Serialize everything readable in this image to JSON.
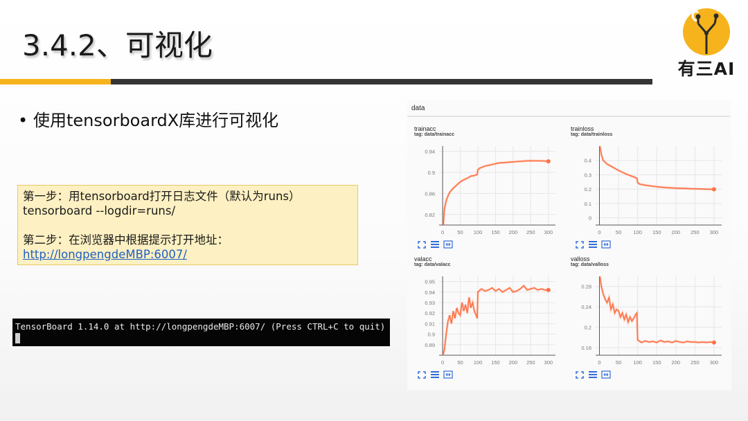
{
  "slide": {
    "title": "3.4.2、可视化",
    "logo_text": "有三AI",
    "bullet": "使用tensorboardX库进行可视化",
    "steps": {
      "line1": "第一步：用tensorboard打开日志文件（默认为runs）",
      "line2": "tensorboard --logdir=runs/",
      "line3": "第二步：在浏览器中根据提示打开地址：",
      "link": "http://longpengdeMBP:6007/"
    },
    "terminal": {
      "line1": "TensorBoard 1.14.0 at http://longpengdeMBP:6007/ (Press CTRL+C to quit)"
    },
    "colors": {
      "accent_yellow": "#f6b31c",
      "bar_dark": "#353535",
      "series": "#ff7043"
    }
  },
  "tensorboard": {
    "header": "data",
    "icons": [
      "expand-icon",
      "list-icon",
      "fit-domain-icon"
    ]
  },
  "chart_data": [
    {
      "type": "line",
      "title": "trainacc",
      "tag": "tag: data/trainacc",
      "xticks": [
        0,
        50,
        100,
        150,
        200,
        250,
        300
      ],
      "yticks": [
        0.82,
        0.86,
        0.9,
        0.94
      ],
      "xlim": [
        -10,
        320
      ],
      "ylim": [
        0.8,
        0.95
      ],
      "x": [
        2,
        5,
        10,
        15,
        20,
        30,
        40,
        50,
        60,
        70,
        80,
        90,
        98,
        100,
        105,
        120,
        140,
        160,
        180,
        200,
        220,
        240,
        260,
        280,
        300
      ],
      "y": [
        0.8,
        0.83,
        0.846,
        0.855,
        0.862,
        0.87,
        0.876,
        0.882,
        0.886,
        0.889,
        0.893,
        0.894,
        0.896,
        0.905,
        0.908,
        0.912,
        0.915,
        0.918,
        0.919,
        0.92,
        0.921,
        0.922,
        0.922,
        0.922,
        0.921
      ]
    },
    {
      "type": "line",
      "title": "trainloss",
      "tag": "tag: data/trainloss",
      "xticks": [
        0,
        50,
        100,
        150,
        200,
        250,
        300
      ],
      "yticks": [
        0,
        0.1,
        0.2,
        0.3,
        0.4
      ],
      "xlim": [
        -10,
        320
      ],
      "ylim": [
        -0.05,
        0.5
      ],
      "x": [
        1,
        5,
        10,
        20,
        30,
        40,
        50,
        60,
        70,
        80,
        90,
        98,
        100,
        105,
        120,
        140,
        160,
        180,
        200,
        220,
        240,
        260,
        280,
        300
      ],
      "y": [
        0.5,
        0.44,
        0.4,
        0.375,
        0.36,
        0.345,
        0.33,
        0.318,
        0.305,
        0.295,
        0.285,
        0.275,
        0.245,
        0.235,
        0.228,
        0.22,
        0.214,
        0.21,
        0.207,
        0.205,
        0.203,
        0.202,
        0.2,
        0.199
      ]
    },
    {
      "type": "line",
      "title": "valacc",
      "tag": "tag: data/valacc",
      "xticks": [
        0,
        50,
        100,
        150,
        200,
        250,
        300
      ],
      "yticks": [
        0.89,
        0.9,
        0.91,
        0.92,
        0.93,
        0.94,
        0.95
      ],
      "xlim": [
        -10,
        320
      ],
      "ylim": [
        0.88,
        0.955
      ],
      "x": [
        1,
        5,
        10,
        15,
        20,
        25,
        30,
        35,
        40,
        45,
        50,
        55,
        60,
        65,
        70,
        75,
        80,
        85,
        90,
        95,
        98,
        100,
        110,
        120,
        130,
        140,
        150,
        160,
        170,
        180,
        190,
        200,
        210,
        220,
        230,
        240,
        250,
        260,
        270,
        280,
        290,
        300
      ],
      "y": [
        0.88,
        0.885,
        0.9,
        0.912,
        0.918,
        0.91,
        0.922,
        0.915,
        0.925,
        0.92,
        0.918,
        0.93,
        0.922,
        0.928,
        0.92,
        0.935,
        0.925,
        0.93,
        0.922,
        0.918,
        0.915,
        0.94,
        0.943,
        0.941,
        0.942,
        0.944,
        0.941,
        0.943,
        0.94,
        0.942,
        0.944,
        0.94,
        0.941,
        0.943,
        0.946,
        0.942,
        0.943,
        0.944,
        0.942,
        0.943,
        0.942,
        0.942
      ]
    },
    {
      "type": "line",
      "title": "valloss",
      "tag": "tag: data/valloss",
      "xticks": [
        0,
        50,
        100,
        150,
        200,
        250,
        300
      ],
      "yticks": [
        0.16,
        0.2,
        0.24,
        0.28
      ],
      "xlim": [
        -10,
        320
      ],
      "ylim": [
        0.145,
        0.3
      ],
      "x": [
        1,
        5,
        10,
        15,
        20,
        25,
        30,
        35,
        40,
        45,
        50,
        55,
        60,
        65,
        70,
        75,
        80,
        85,
        90,
        95,
        98,
        100,
        110,
        120,
        130,
        140,
        150,
        160,
        170,
        180,
        190,
        200,
        210,
        220,
        230,
        240,
        250,
        260,
        270,
        280,
        290,
        300
      ],
      "y": [
        0.3,
        0.28,
        0.265,
        0.255,
        0.248,
        0.258,
        0.235,
        0.245,
        0.228,
        0.235,
        0.232,
        0.22,
        0.228,
        0.215,
        0.225,
        0.21,
        0.22,
        0.212,
        0.218,
        0.225,
        0.228,
        0.175,
        0.17,
        0.173,
        0.171,
        0.172,
        0.17,
        0.174,
        0.171,
        0.172,
        0.17,
        0.173,
        0.171,
        0.17,
        0.172,
        0.171,
        0.171,
        0.17,
        0.171,
        0.17,
        0.171,
        0.17
      ]
    }
  ]
}
